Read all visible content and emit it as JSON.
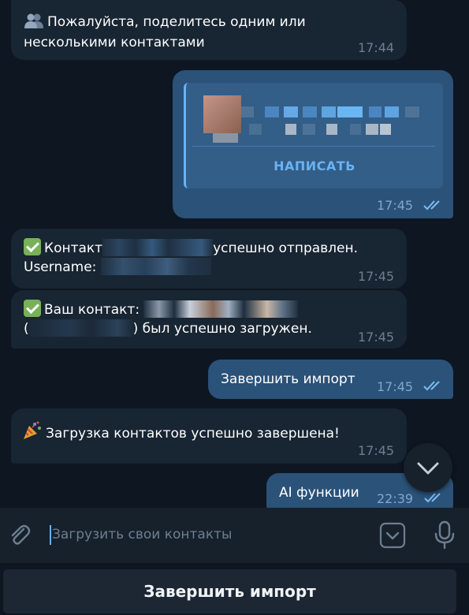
{
  "messages": {
    "m1": {
      "icon": "busts-in-silhouette-icon",
      "line1": "Пожалуйста, поделитесь одним или",
      "line2": "несколькими контактами",
      "time": "17:44"
    },
    "m2": {
      "action_label": "НАПИСАТЬ",
      "time": "17:45"
    },
    "m3": {
      "line1_prefix": "Контакт",
      "line1_suffix": "успешно отправлен.",
      "line2_prefix": "Username:",
      "time": "17:45"
    },
    "m4": {
      "line1_prefix": "Ваш контакт:",
      "line2_open": "(",
      "line2_suffix": ") был успешно загружен.",
      "time": "17:45"
    },
    "m5": {
      "text": "Завершить импорт",
      "time": "17:45"
    },
    "m6": {
      "icon": "party-popper-icon",
      "text": "Загрузка контактов успешно завершена!",
      "time": "17:45"
    },
    "m7": {
      "text": "AI функции",
      "time": "22:39"
    }
  },
  "composer": {
    "placeholder": "Загрузить свои контакты"
  },
  "keyboard": {
    "button_label": "Завершить импорт"
  },
  "colors": {
    "background": "#0e1621",
    "incoming_bubble": "#182533",
    "outgoing_bubble": "#2b5278",
    "accent": "#5fa8e8",
    "read_ticks": "#6cb4f5"
  }
}
